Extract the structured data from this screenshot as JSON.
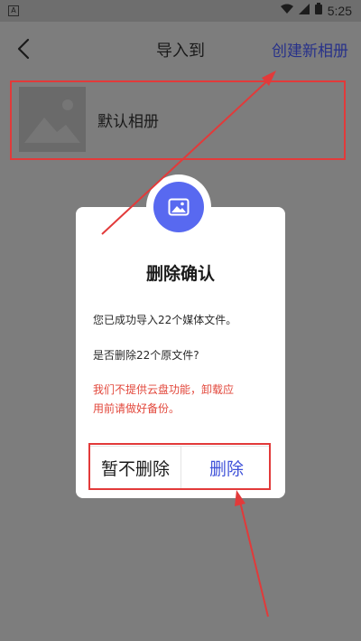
{
  "status_bar": {
    "time": "5:25",
    "icons": [
      "wifi-icon",
      "signal-icon",
      "battery-icon"
    ],
    "badge": "A"
  },
  "header": {
    "title": "导入到",
    "create_album": "创建新相册",
    "back_icon": "chevron-left-icon"
  },
  "album": {
    "name": "默认相册",
    "thumbnail_icon": "image-placeholder-icon"
  },
  "dialog": {
    "icon": "image-icon",
    "title": "删除确认",
    "message1": "您已成功导入22个媒体文件。",
    "message2": "是否删除22个原文件?",
    "warning_line1": "我们不提供云盘功能，卸载应",
    "warning_line2": "用前请做好备份。",
    "cancel": "暂不删除",
    "delete": "删除"
  },
  "colors": {
    "accent": "#5869f0",
    "link": "#27318a",
    "warning": "#e2473b",
    "annotation": "#e23a3a"
  }
}
